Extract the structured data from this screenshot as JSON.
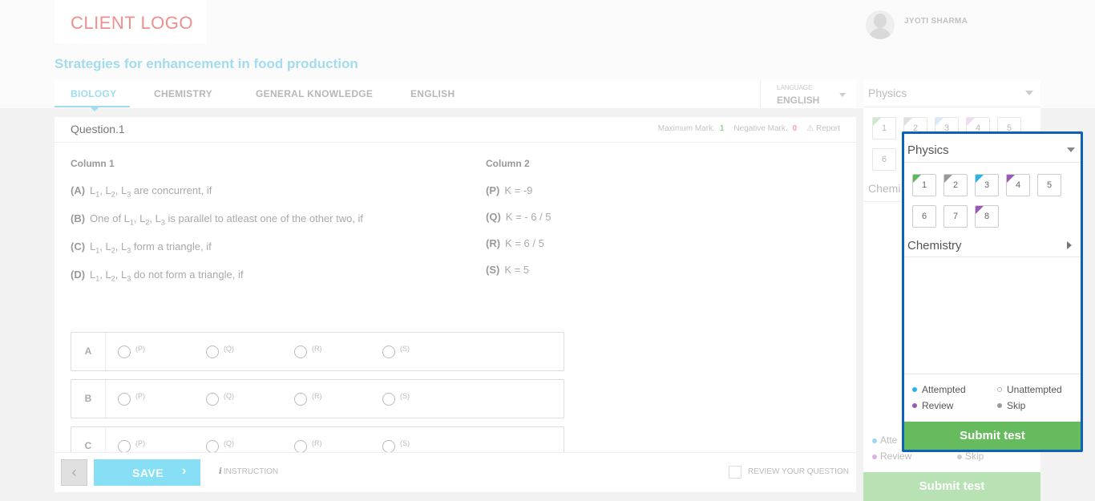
{
  "header": {
    "logo_text": "CLIENT LOGO",
    "user_name": "JYOTI SHARMA",
    "page_title": "Strategies for enhancement in food production"
  },
  "tabs": {
    "items": [
      "BIOLOGY",
      "CHEMISTRY",
      "GENERAL KNOWLEDGE",
      "ENGLISH"
    ],
    "active": "BIOLOGY",
    "language_label": "LANGUAGE",
    "language_value": "ENGLISH"
  },
  "question": {
    "title": "Question.1",
    "max_mark_label": "Maximum Mark.",
    "max_mark_value": "1",
    "neg_mark_label": "Negative Mark.",
    "neg_mark_value": "0",
    "report_label": "Report",
    "column1_heading": "Column 1",
    "column2_heading": "Column 2",
    "column1": [
      {
        "key": "(A)",
        "text": "L1, L2, L3 are concurrent, if"
      },
      {
        "key": "(B)",
        "text": "One of L1, L2, L3 is parallel to atleast one of the other two, if"
      },
      {
        "key": "(C)",
        "text": "L1, L2, L3 form a triangle, if"
      },
      {
        "key": "(D)",
        "text": "L1, L2, L3 do not form a triangle, if"
      }
    ],
    "column2": [
      {
        "key": "(P)",
        "text": "K = -9"
      },
      {
        "key": "(Q)",
        "text": "K = - 6 / 5"
      },
      {
        "key": "(R)",
        "text": "K = 6 / 5"
      },
      {
        "key": "(S)",
        "text": "K = 5"
      }
    ],
    "match_rows": [
      "A",
      "B",
      "C"
    ],
    "match_options": [
      "(P)",
      "(Q)",
      "(R)",
      "(S)"
    ]
  },
  "footer": {
    "prev_symbol": "‹",
    "save_label": "SAVE",
    "save_chevron": "›",
    "instruction_icon": "i",
    "instruction_label": "INSTRUCTION",
    "review_label": "REVIEW YOUR QUESTION"
  },
  "palette": {
    "subject": "Physics",
    "chemistry": "Chemistry",
    "questions": [
      {
        "n": "1",
        "status": "attempted-green"
      },
      {
        "n": "2",
        "status": "skip"
      },
      {
        "n": "3",
        "status": "attempted"
      },
      {
        "n": "4",
        "status": "review"
      },
      {
        "n": "5",
        "status": "unattempted"
      },
      {
        "n": "6",
        "status": "unattempted"
      },
      {
        "n": "7",
        "status": "unattempted"
      },
      {
        "n": "8",
        "status": "review"
      }
    ],
    "legend": {
      "attempted": "Attempted",
      "unattempted": "Unattempted",
      "review": "Review",
      "skip": "Skip"
    },
    "submit_label": "Submit test",
    "colors": {
      "attempted": "#2ab3e6",
      "attempted_green": "#5cb85c",
      "review": "#9b59b6",
      "skip": "#999999",
      "border": "#0b62b7",
      "submit": "#66bb5f"
    }
  },
  "faded_panel": {
    "subject": "Physics",
    "chemistry_partial": "Chemi",
    "questions": [
      "1",
      "2",
      "3",
      "4",
      "5",
      "6"
    ],
    "legend_attempted_partial": "Atte",
    "legend_review": "Review",
    "legend_skip": "Skip",
    "submit_label": "Submit test"
  }
}
